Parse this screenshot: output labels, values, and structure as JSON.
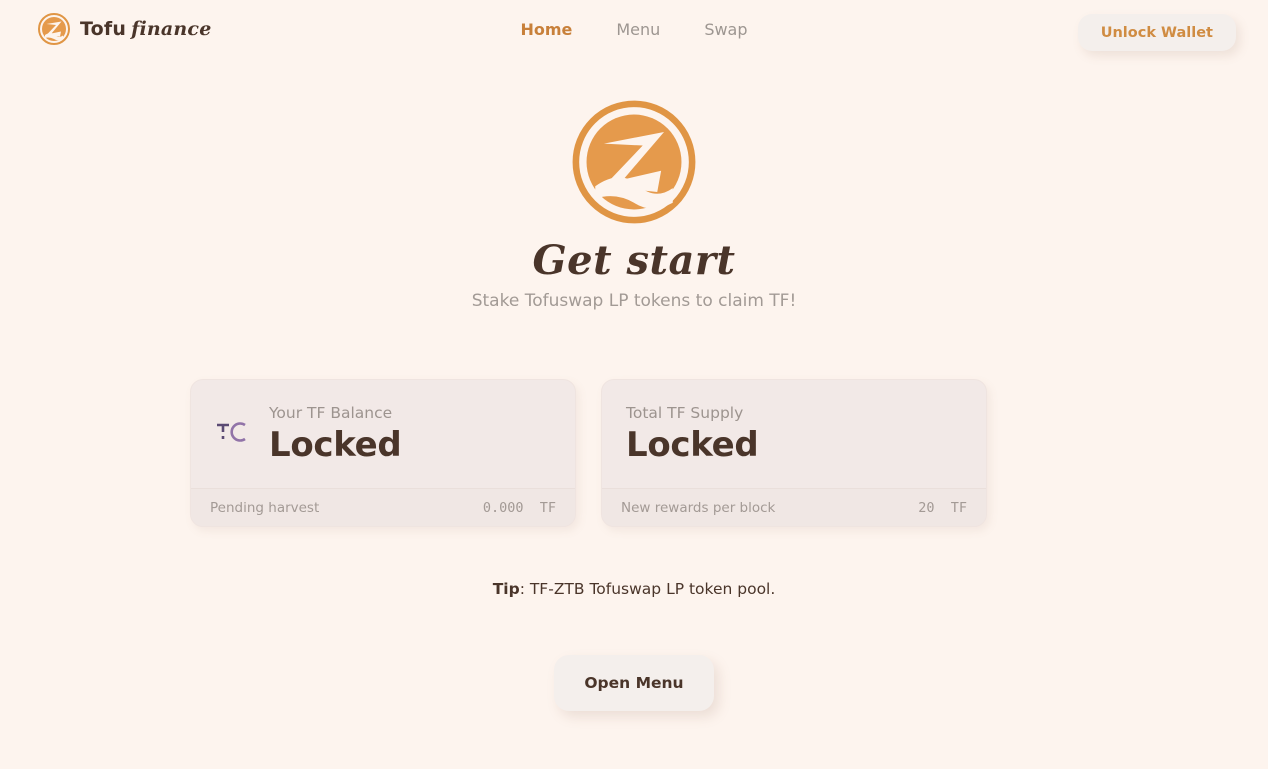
{
  "brand": {
    "logo_icon": "tofu-coin-logo-icon",
    "name_primary": "Tofu",
    "name_secondary": "finance"
  },
  "nav": {
    "items": [
      {
        "label": "Home",
        "active": true
      },
      {
        "label": "Menu",
        "active": false
      },
      {
        "label": "Swap",
        "active": false
      }
    ]
  },
  "header": {
    "wallet_button_label": "Unlock Wallet"
  },
  "hero": {
    "logo_icon": "tofu-coin-logo-icon",
    "title": "Get start",
    "subtitle": "Stake Tofuswap LP tokens to claim TF!"
  },
  "cards": [
    {
      "icon": "tf-token-icon",
      "label": "Your TF Balance",
      "value": "Locked",
      "foot_label": "Pending harvest",
      "foot_value": "0.000  TF"
    },
    {
      "icon": null,
      "label": "Total TF Supply",
      "value": "Locked",
      "foot_label": "New rewards per block",
      "foot_value": "20  TF"
    }
  ],
  "tip": {
    "prefix": "Tip",
    "text": ": TF-ZTB Tofuswap LP token pool."
  },
  "actions": {
    "open_menu_label": "Open Menu"
  },
  "colors": {
    "page_background": "#fdf4ee",
    "brand_orange": "#e08b3e",
    "accent_text": "#c8803a",
    "heading_brown": "#4a352a",
    "muted_text": "#a29a95",
    "card_background": "#f2e9e7",
    "token_icon_purple": "#7d5f96"
  }
}
